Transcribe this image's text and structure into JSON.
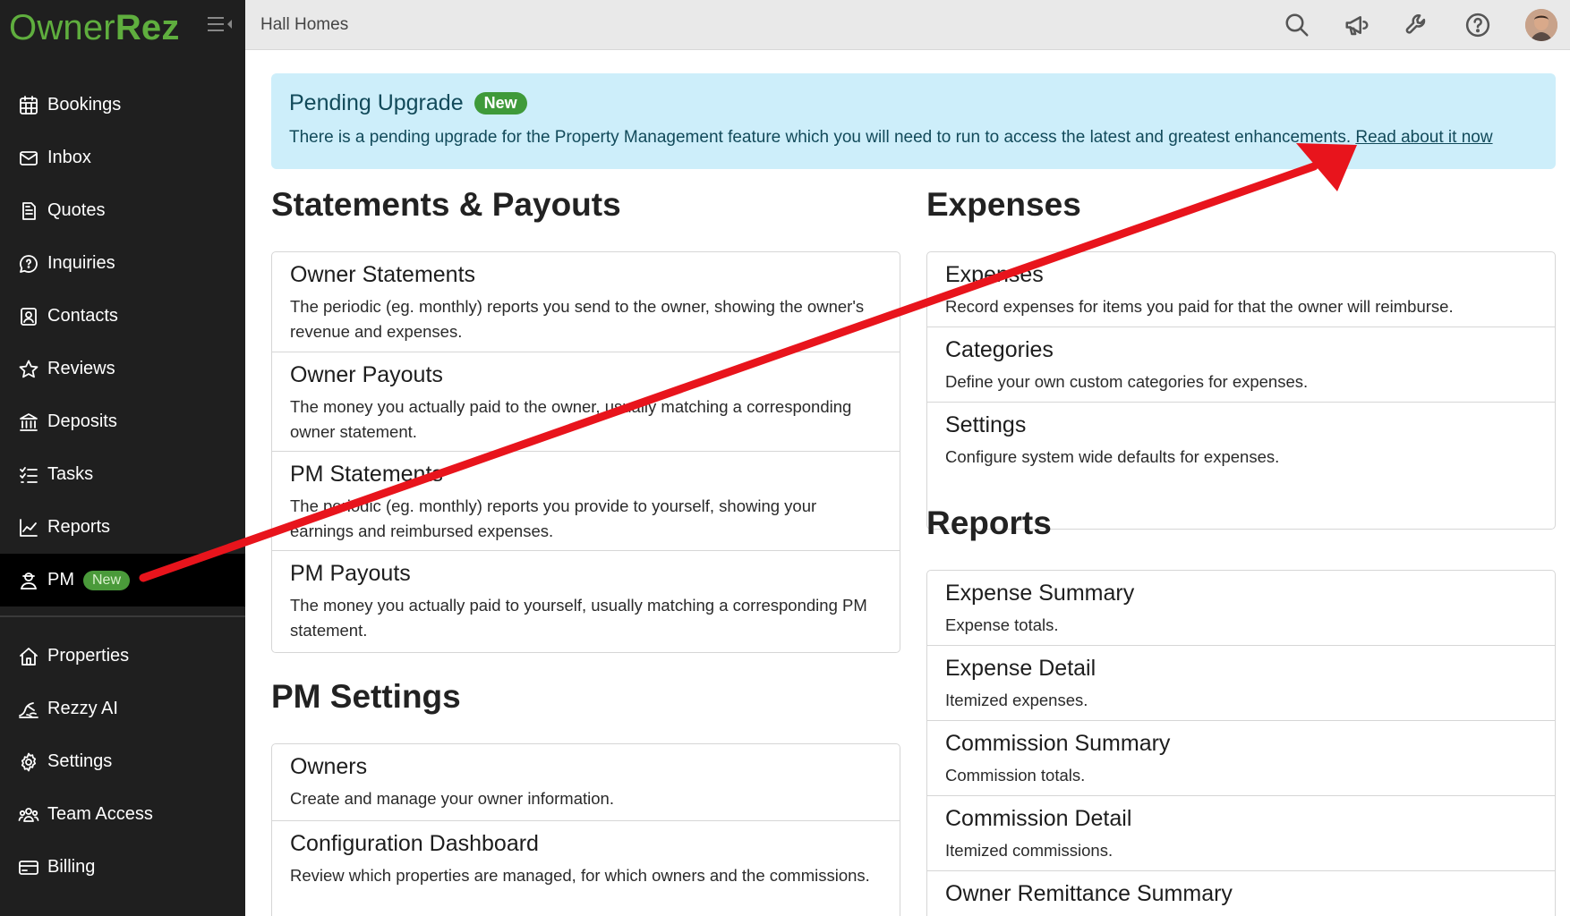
{
  "app": {
    "logo_owner": "Owner",
    "logo_rez": "Rez",
    "account_name": "Hall Homes"
  },
  "sidebar": {
    "items": [
      {
        "label": "Bookings",
        "icon": "calendar-icon"
      },
      {
        "label": "Inbox",
        "icon": "envelope-icon"
      },
      {
        "label": "Quotes",
        "icon": "document-icon"
      },
      {
        "label": "Inquiries",
        "icon": "chat-question-icon"
      },
      {
        "label": "Contacts",
        "icon": "contact-card-icon"
      },
      {
        "label": "Reviews",
        "icon": "star-icon"
      },
      {
        "label": "Deposits",
        "icon": "bank-icon"
      },
      {
        "label": "Tasks",
        "icon": "checklist-icon"
      },
      {
        "label": "Reports",
        "icon": "line-chart-icon"
      },
      {
        "label": "PM",
        "icon": "person-icon",
        "badge": "New",
        "active": true
      }
    ],
    "secondary_items": [
      {
        "label": "Properties",
        "icon": "house-icon"
      },
      {
        "label": "Rezzy AI",
        "icon": "rezzy-icon"
      },
      {
        "label": "Settings",
        "icon": "gear-icon"
      },
      {
        "label": "Team Access",
        "icon": "team-icon"
      },
      {
        "label": "Billing",
        "icon": "credit-card-icon"
      }
    ]
  },
  "topbar": {
    "icons": [
      "search-icon",
      "megaphone-icon",
      "wrench-icon",
      "help-icon"
    ]
  },
  "banner": {
    "title": "Pending Upgrade",
    "badge": "New",
    "text": "There is a pending upgrade for the Property Management feature which you will need to run to access the latest and greatest enhancements.",
    "link": "Read about it now"
  },
  "sections": {
    "statements": {
      "title": "Statements & Payouts",
      "cards": [
        {
          "title": "Owner Statements",
          "desc": "The periodic (eg. monthly) reports you send to the owner, showing the owner's revenue and expenses."
        },
        {
          "title": "Owner Payouts",
          "desc": "The money you actually paid to the owner, usually matching a corresponding owner statement."
        },
        {
          "title": "PM Statements",
          "desc": "The periodic (eg. monthly) reports you provide to yourself, showing your earnings and reimbursed expenses."
        },
        {
          "title": "PM Payouts",
          "desc": "The money you actually paid to yourself, usually matching a corresponding PM statement."
        }
      ]
    },
    "pm_settings": {
      "title": "PM Settings",
      "cards": [
        {
          "title": "Owners",
          "desc": "Create and manage your owner information."
        },
        {
          "title": "Configuration Dashboard",
          "desc": "Review which properties are managed, for which owners and the commissions."
        }
      ]
    },
    "expenses": {
      "title": "Expenses",
      "cards": [
        {
          "title": "Expenses",
          "desc": "Record expenses for items you paid for that the owner will reimburse."
        },
        {
          "title": "Categories",
          "desc": "Define your own custom categories for expenses."
        },
        {
          "title": "Settings",
          "desc": "Configure system wide defaults for expenses."
        }
      ]
    },
    "reports": {
      "title": "Reports",
      "cards": [
        {
          "title": "Expense Summary",
          "desc": "Expense totals."
        },
        {
          "title": "Expense Detail",
          "desc": "Itemized expenses."
        },
        {
          "title": "Commission Summary",
          "desc": "Commission totals."
        },
        {
          "title": "Commission Detail",
          "desc": "Itemized commissions."
        },
        {
          "title": "Owner Remittance Summary",
          "desc": ""
        }
      ]
    }
  },
  "colors": {
    "brand_green": "#5fae3e",
    "sidebar_bg": "#1f1f1f",
    "banner_bg": "#cdeefa",
    "annotation_red": "#e8141c"
  }
}
